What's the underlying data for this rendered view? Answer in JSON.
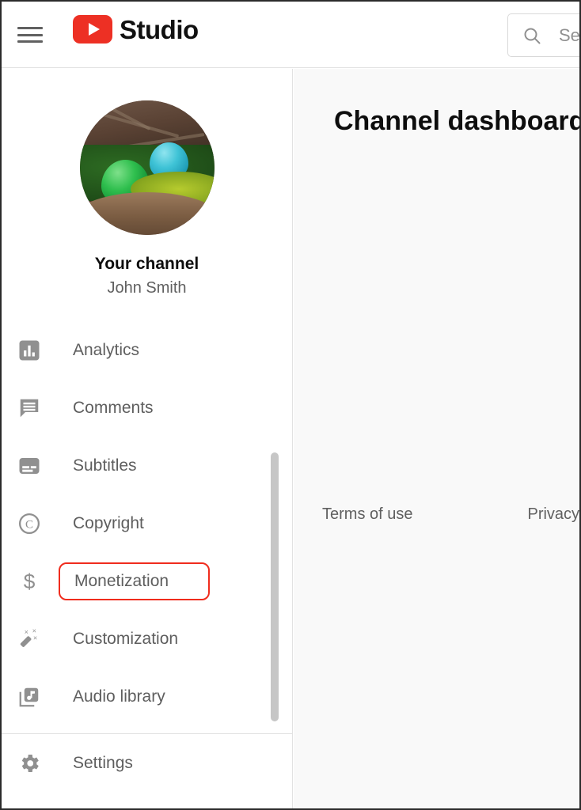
{
  "header": {
    "menu_icon": "hamburger-menu-icon",
    "logo_icon": "youtube-play-logo-icon",
    "brand_text": "Studio",
    "brand_accent_color": "#ED3024",
    "search": {
      "icon": "search-icon",
      "value": "",
      "placeholder": "Sea"
    }
  },
  "sidebar": {
    "channel": {
      "avatar_icon": "channel-avatar",
      "title": "Your channel",
      "subtitle": "John Smith"
    },
    "items": [
      {
        "label": "Analytics",
        "icon": "analytics-bar-chart-icon",
        "highlighted": false
      },
      {
        "label": "Comments",
        "icon": "comments-speech-bubble-icon",
        "highlighted": false
      },
      {
        "label": "Subtitles",
        "icon": "subtitles-caption-icon",
        "highlighted": false
      },
      {
        "label": "Copyright",
        "icon": "copyright-circle-c-icon",
        "highlighted": false
      },
      {
        "label": "Monetization",
        "icon": "monetization-dollar-sign-icon",
        "highlighted": true
      },
      {
        "label": "Customization",
        "icon": "customization-magic-wand-icon",
        "highlighted": false
      },
      {
        "label": "Audio library",
        "icon": "audio-library-music-note-icon",
        "highlighted": false
      }
    ],
    "settings": {
      "label": "Settings",
      "icon": "settings-gear-icon"
    },
    "highlight_color": "#f02c1d",
    "scrollbar": {
      "name": "sidebar-scrollbar"
    }
  },
  "main": {
    "title": "Channel dashboard",
    "footer": {
      "terms_label": "Terms of use",
      "privacy_label": "Privacy policy"
    }
  }
}
